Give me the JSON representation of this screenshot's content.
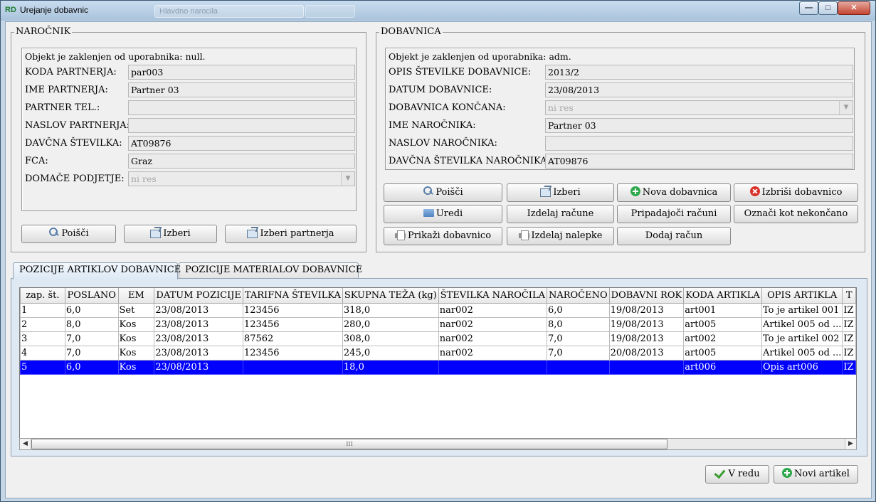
{
  "window": {
    "title": "Urejanje dobavnic",
    "app_icon": "RD",
    "ghost_tab_label": "Hlavdno narocila",
    "controls": {
      "minimize": "—",
      "maximize": "□",
      "close": "✕"
    }
  },
  "narocnik": {
    "legend": "NAROČNIK",
    "lock_message": "Objekt je zaklenjen od uporabnika: null.",
    "fields": [
      {
        "label": "KODA PARTNERJA:",
        "value": "par003"
      },
      {
        "label": "IME PARTNERJA:",
        "value": "Partner 03"
      },
      {
        "label": "PARTNER TEL.:",
        "value": ""
      },
      {
        "label": "NASLOV PARTNERJA:",
        "value": ""
      },
      {
        "label": "DAVČNA ŠTEVILKA:",
        "value": "AT09876"
      },
      {
        "label": "FCA:",
        "value": "Graz"
      },
      {
        "label": "DOMAČE PODJETJE:",
        "value": "ni res"
      }
    ],
    "buttons": {
      "search": "Poišči",
      "select": "Izberi",
      "select_partner": "Izberi partnerja"
    }
  },
  "dobavnica": {
    "legend": "DOBAVNICA",
    "lock_message": "Objekt je zaklenjen od uporabnika: adm.",
    "fields": [
      {
        "label": "OPIS ŠTEVILKE DOBAVNICE:",
        "value": "2013/2"
      },
      {
        "label": "DATUM DOBAVNICE:",
        "value": "23/08/2013"
      },
      {
        "label": "DOBAVNICA KONČANA:",
        "value": "ni res"
      },
      {
        "label": "IME NAROČNIKA:",
        "value": "Partner 03"
      },
      {
        "label": "NASLOV NAROČNIKA:",
        "value": ""
      },
      {
        "label": "DAVČNA ŠTEVILKA NAROČNIKA:",
        "value": "AT09876"
      }
    ],
    "buttons": {
      "search": "Poišči",
      "select": "Izberi",
      "new_dobavnica": "Nova dobavnica",
      "delete_dobavnica": "Izbriši dobavnico",
      "edit": "Uredi",
      "create_invoices": "Izdelaj račune",
      "related_invoices": "Pripadajoči računi",
      "mark_unfinished": "Označi kot nekončano",
      "show_dobavnica": "Prikaži dobavnico",
      "create_labels": "Izdelaj nalepke",
      "add_invoice": "Dodaj račun"
    }
  },
  "tabs": [
    {
      "label": "POZICIJE ARTIKLOV DOBAVNICE",
      "active": true
    },
    {
      "label": "POZICIJE MATERIALOV DOBAVNICE",
      "active": false
    }
  ],
  "grid": {
    "columns": [
      "zap. št.",
      "POSLANO",
      "EM",
      "DATUM POZICIJE",
      "TARIFNA ŠTEVILKA",
      "SKUPNA TEŽA (kg)",
      "ŠTEVILKA NAROČILA",
      "NAROČENO",
      "DOBAVNI ROK",
      "KODA ARTIKLA",
      "OPIS ARTIKLA",
      "T"
    ],
    "rows": [
      [
        "1",
        "6,0",
        "Set",
        "23/08/2013",
        "123456",
        "318,0",
        "nar002",
        "6,0",
        "19/08/2013",
        "art001",
        "To je artikel 001",
        "IZ"
      ],
      [
        "2",
        "8,0",
        "Kos",
        "23/08/2013",
        "123456",
        "280,0",
        "nar002",
        "8,0",
        "19/08/2013",
        "art005",
        "Artikel 005 od ...",
        "IZ"
      ],
      [
        "3",
        "7,0",
        "Kos",
        "23/08/2013",
        "87562",
        "308,0",
        "nar002",
        "7,0",
        "19/08/2013",
        "art002",
        "To je artikel 002",
        "IZ"
      ],
      [
        "4",
        "7,0",
        "Kos",
        "23/08/2013",
        "123456",
        "245,0",
        "nar002",
        "7,0",
        "20/08/2013",
        "art005",
        "Artikel 005 od ...",
        "IZ"
      ],
      [
        "5",
        "6,0",
        "Kos",
        "23/08/2013",
        "",
        "18,0",
        "",
        "",
        "",
        "art006",
        "Opis art006",
        "IZ"
      ]
    ],
    "selected_row": 5,
    "scroll_thumb_label": "III"
  },
  "footer": {
    "ok": "V redu",
    "new_article": "Novi artikel"
  },
  "colors": {
    "selection": "#0000ff",
    "window_frame": "#c5d6e6",
    "ok_icon": "#3a9b2f",
    "add_icon": "#2ea84a",
    "delete_icon": "#d8332b"
  }
}
